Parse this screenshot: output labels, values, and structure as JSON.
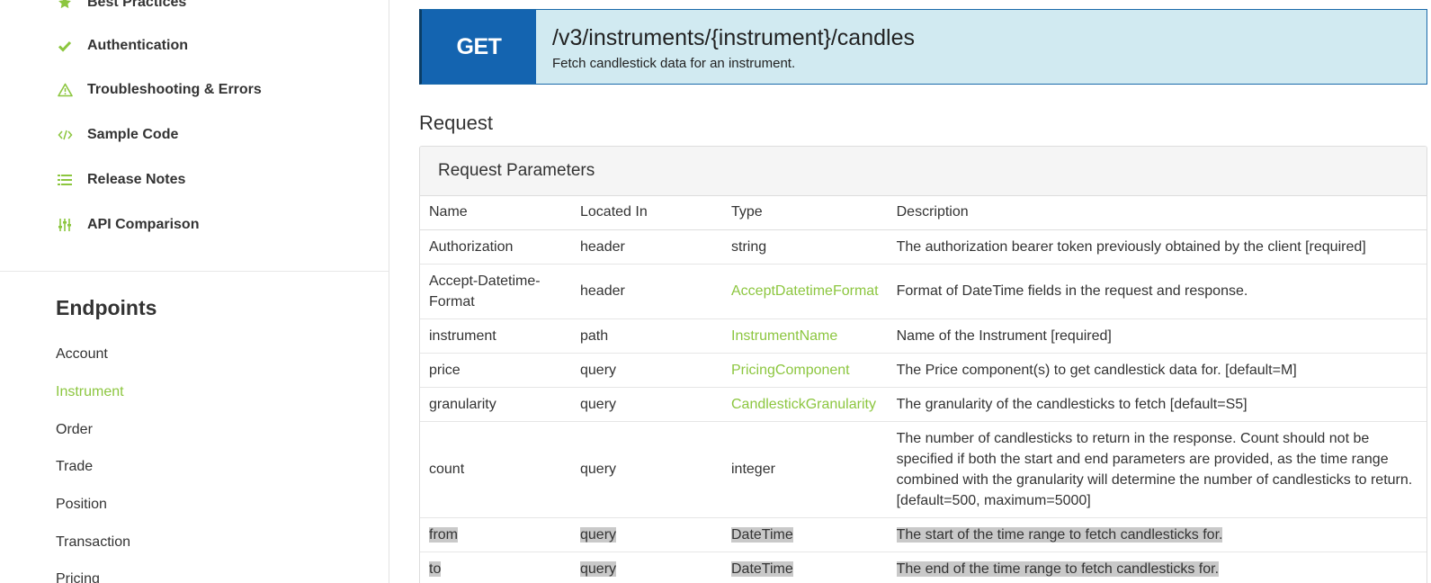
{
  "sidebar": {
    "nav_items": [
      {
        "label": "Best Practices",
        "icon": "star-icon"
      },
      {
        "label": "Authentication",
        "icon": "check-icon"
      },
      {
        "label": "Troubleshooting & Errors",
        "icon": "warning-icon"
      },
      {
        "label": "Sample Code",
        "icon": "code-icon"
      },
      {
        "label": "Release Notes",
        "icon": "list-icon"
      },
      {
        "label": "API Comparison",
        "icon": "sliders-icon"
      }
    ],
    "endpoints_heading": "Endpoints",
    "endpoints": [
      {
        "label": "Account"
      },
      {
        "label": "Instrument",
        "active": true
      },
      {
        "label": "Order"
      },
      {
        "label": "Trade"
      },
      {
        "label": "Position"
      },
      {
        "label": "Transaction"
      },
      {
        "label": "Pricing"
      }
    ]
  },
  "endpoint": {
    "method": "GET",
    "path": "/v3/instruments/{instrument}/candles",
    "description": "Fetch candlestick data for an instrument."
  },
  "request": {
    "heading": "Request",
    "panel_title": "Request Parameters",
    "columns": [
      "Name",
      "Located In",
      "Type",
      "Description"
    ],
    "rows": [
      {
        "name": "Authorization",
        "located_in": "header",
        "type": "string",
        "type_link": false,
        "description": "The authorization bearer token previously obtained by the client [required]"
      },
      {
        "name": "Accept-Datetime-Format",
        "located_in": "header",
        "type": "AcceptDatetimeFormat",
        "type_link": true,
        "description": "Format of DateTime fields in the request and response."
      },
      {
        "name": "instrument",
        "located_in": "path",
        "type": "InstrumentName",
        "type_link": true,
        "description": "Name of the Instrument [required]"
      },
      {
        "name": "price",
        "located_in": "query",
        "type": "PricingComponent",
        "type_link": true,
        "description": "The Price component(s) to get candlestick data for. [default=M]"
      },
      {
        "name": "granularity",
        "located_in": "query",
        "type": "CandlestickGranularity",
        "type_link": true,
        "description": "The granularity of the candlesticks to fetch [default=S5]"
      },
      {
        "name": "count",
        "located_in": "query",
        "type": "integer",
        "type_link": false,
        "description": "The number of candlesticks to return in the response. Count should not be specified if both the start and end parameters are provided, as the time range combined with the granularity will determine the number of candlesticks to return. [default=500, maximum=5000]"
      },
      {
        "name": "from",
        "located_in": "query",
        "type": "DateTime",
        "type_link": false,
        "selected": true,
        "description": "The start of the time range to fetch candlesticks for."
      },
      {
        "name": "to",
        "located_in": "query",
        "type": "DateTime",
        "type_link": false,
        "selected": true,
        "description": "The end of the time range to fetch candlesticks for."
      }
    ]
  },
  "colors": {
    "accent_green": "#8cc63f",
    "method_blue": "#1464b0",
    "banner_bg": "#d1eaf1",
    "selection_gray": "#c9c9c9"
  }
}
